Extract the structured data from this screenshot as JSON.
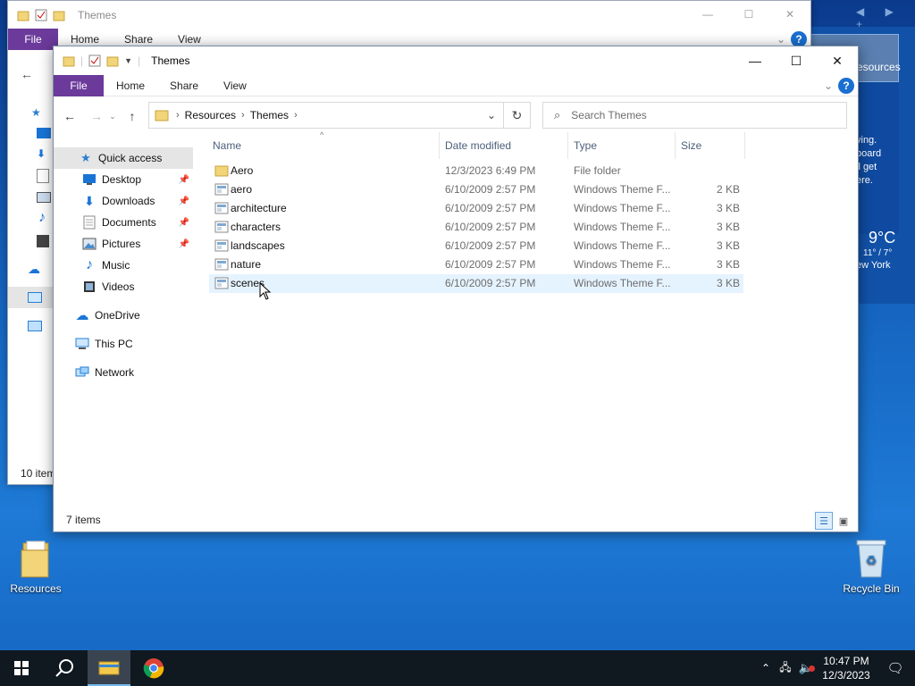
{
  "desktop": {
    "icons": [
      {
        "label": "Resources",
        "icon": "folder-icon"
      },
      {
        "label": "Recycle Bin",
        "icon": "recycle-bin-icon"
      }
    ],
    "widget": {
      "nav": "◀ ▶ +",
      "tab_label": "esources",
      "lines": [
        "ying.",
        "board",
        "ll get",
        "ere."
      ],
      "temp": "9°C",
      "range": "11° / 7°",
      "city": "ew York"
    }
  },
  "back_window": {
    "title": "Themes",
    "ribbon": {
      "file": "File",
      "tabs": [
        "Home",
        "Share",
        "View"
      ]
    },
    "status": "10 item"
  },
  "window": {
    "title": "Themes",
    "ribbon": {
      "file": "File",
      "tabs": [
        "Home",
        "Share",
        "View"
      ],
      "help": "?"
    },
    "breadcrumb": [
      "Resources",
      "Themes"
    ],
    "search_placeholder": "Search Themes",
    "nav": {
      "quick_access": "Quick access",
      "pinned": [
        {
          "label": "Desktop",
          "icon": "desktop-icon"
        },
        {
          "label": "Downloads",
          "icon": "download-icon"
        },
        {
          "label": "Documents",
          "icon": "documents-icon"
        },
        {
          "label": "Pictures",
          "icon": "pictures-icon"
        },
        {
          "label": "Music",
          "icon": "music-icon"
        },
        {
          "label": "Videos",
          "icon": "videos-icon"
        }
      ],
      "onedrive": "OneDrive",
      "thispc": "This PC",
      "network": "Network"
    },
    "columns": {
      "name": "Name",
      "date": "Date modified",
      "type": "Type",
      "size": "Size"
    },
    "files": [
      {
        "name": "Aero",
        "date": "12/3/2023 6:49 PM",
        "type": "File folder",
        "size": "",
        "kind": "folder"
      },
      {
        "name": "aero",
        "date": "6/10/2009 2:57 PM",
        "type": "Windows Theme F...",
        "size": "2 KB",
        "kind": "theme"
      },
      {
        "name": "architecture",
        "date": "6/10/2009 2:57 PM",
        "type": "Windows Theme F...",
        "size": "3 KB",
        "kind": "theme"
      },
      {
        "name": "characters",
        "date": "6/10/2009 2:57 PM",
        "type": "Windows Theme F...",
        "size": "3 KB",
        "kind": "theme"
      },
      {
        "name": "landscapes",
        "date": "6/10/2009 2:57 PM",
        "type": "Windows Theme F...",
        "size": "3 KB",
        "kind": "theme"
      },
      {
        "name": "nature",
        "date": "6/10/2009 2:57 PM",
        "type": "Windows Theme F...",
        "size": "3 KB",
        "kind": "theme"
      },
      {
        "name": "scenes",
        "date": "6/10/2009 2:57 PM",
        "type": "Windows Theme F...",
        "size": "3 KB",
        "kind": "theme"
      }
    ],
    "status": "7 items"
  },
  "taskbar": {
    "time": "10:47 PM",
    "date": "12/3/2023"
  },
  "colors": {
    "file_tab": "#6b3a9a",
    "selection": "#cce8ff",
    "hover_row": "#e5f3ff",
    "taskbar": "#101820"
  }
}
